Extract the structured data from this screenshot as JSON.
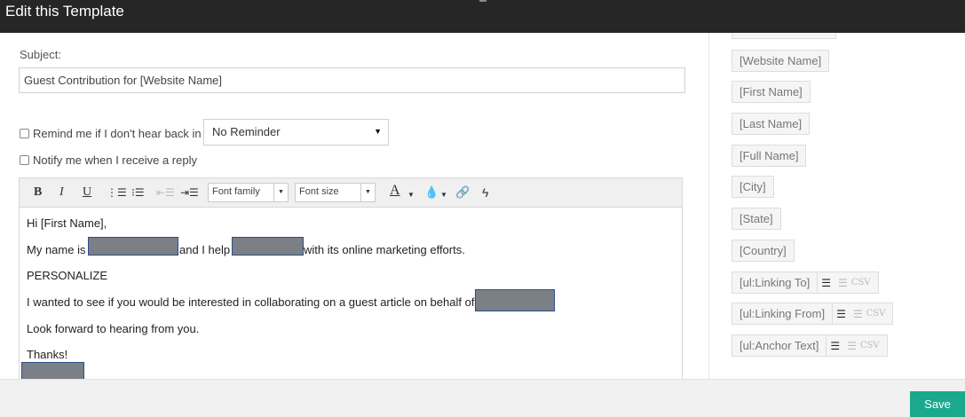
{
  "window": {
    "title": "Edit this Template"
  },
  "subject": {
    "label": "Subject:",
    "value": "Guest Contribution for [Website Name]"
  },
  "reminder": {
    "label": "Remind me if I don't hear back in",
    "selected": "No Reminder"
  },
  "notify": {
    "label": "Notify me when I receive a reply"
  },
  "toolbar": {
    "font_family": "Font family",
    "font_size": "Font size"
  },
  "body": {
    "greeting": "Hi [First Name],",
    "intro_a": "My name is",
    "intro_b": "and I help",
    "intro_c": "with its online marketing efforts.",
    "personalize": "PERSONALIZE",
    "pitch": "I wanted to see if you would be interested in collaborating on a guest article on behalf of",
    "closing": "Look forward to hearing from you.",
    "signoff": "Thanks!"
  },
  "tags": {
    "website_name": "[Website Name]",
    "first_name": "[First Name]",
    "last_name": "[Last Name]",
    "full_name": "[Full Name]",
    "city": "[City]",
    "state": "[State]",
    "country": "[Country]",
    "linking_to": "[ul:Linking To]",
    "linking_from": "[ul:Linking From]",
    "anchor_text": "[ul:Anchor Text]",
    "csv": "CSV"
  },
  "footer": {
    "save_label": "Save"
  },
  "colors": {
    "titlebar": "#262626",
    "save_button": "#1aa98c",
    "redaction": "#7b7f86"
  }
}
